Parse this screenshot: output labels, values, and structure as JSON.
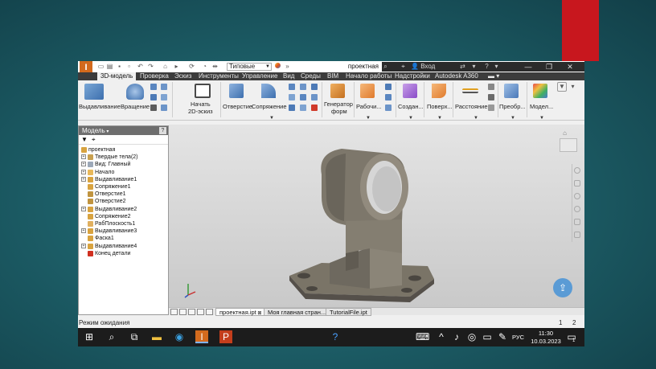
{
  "titlebar": {
    "style_dropdown": "Типовые",
    "document_title": "проектная",
    "signin": "Вход",
    "minimize": "—",
    "maximize": "❐",
    "close": "✕"
  },
  "menu": {
    "tabs": [
      "3D-модель",
      "Проверка",
      "Эскиз",
      "Инструменты",
      "Управление",
      "Вид",
      "Среды",
      "BIM",
      "Начало работы",
      "Надстройки",
      "Autodesk A360"
    ]
  },
  "ribbon": {
    "extrude": "Выдавливание",
    "revolve": "Вращение",
    "start_sketch_1": "Начать",
    "start_sketch_2": "2D-эскиз",
    "hole": "Отверстие",
    "fillet": "Сопряжение",
    "frame_gen_1": "Генератор",
    "frame_gen_2": "форм",
    "work": "Рабочи...",
    "create": "Создан...",
    "surface": "Поверх...",
    "distance": "Расстояние",
    "convert": "Преобр...",
    "model": "Модел..."
  },
  "browser": {
    "title": "Модель",
    "items": [
      {
        "label": "проектная",
        "level": 0,
        "expand": false,
        "icon": "part-icon",
        "color": "#d8a340"
      },
      {
        "label": "Твердые тела(2)",
        "level": 1,
        "expand": true,
        "icon": "solid-bodies-icon",
        "color": "#c8a050"
      },
      {
        "label": "Вид: Главный",
        "level": 1,
        "expand": true,
        "icon": "view-icon",
        "color": "#9ca8b8"
      },
      {
        "label": "Начало",
        "level": 1,
        "expand": true,
        "icon": "origin-icon",
        "color": "#e8b85a"
      },
      {
        "label": "Выдавливание1",
        "level": 1,
        "expand": true,
        "icon": "extrude-icon",
        "color": "#d8a340"
      },
      {
        "label": "Сопряжение1",
        "level": 1,
        "expand": false,
        "icon": "fillet-icon",
        "color": "#d8a340"
      },
      {
        "label": "Отверстие1",
        "level": 1,
        "expand": false,
        "icon": "hole-icon",
        "color": "#c09440"
      },
      {
        "label": "Отверстие2",
        "level": 1,
        "expand": false,
        "icon": "hole-icon",
        "color": "#c09440"
      },
      {
        "label": "Выдавливание2",
        "level": 1,
        "expand": true,
        "icon": "extrude-icon",
        "color": "#d8a340"
      },
      {
        "label": "Сопряжение2",
        "level": 1,
        "expand": false,
        "icon": "fillet-icon",
        "color": "#d8a340"
      },
      {
        "label": "РабПлоскость1",
        "level": 1,
        "expand": false,
        "icon": "workplane-icon",
        "color": "#e0b060"
      },
      {
        "label": "Выдавливание3",
        "level": 1,
        "expand": true,
        "icon": "extrude-icon",
        "color": "#d8a340"
      },
      {
        "label": "Фаска1",
        "level": 1,
        "expand": false,
        "icon": "chamfer-icon",
        "color": "#d8a340"
      },
      {
        "label": "Выдавливание4",
        "level": 1,
        "expand": true,
        "icon": "extrude-icon",
        "color": "#d8a340"
      },
      {
        "label": "Конец детали",
        "level": 1,
        "expand": false,
        "icon": "end-of-part-icon",
        "color": "#d03020"
      }
    ]
  },
  "doc_tabs": [
    {
      "label": "проектная.ipt",
      "active": true
    },
    {
      "label": "Моя главная стран...",
      "active": false
    },
    {
      "label": "TutorialFile.ipt",
      "active": false
    }
  ],
  "status": {
    "text": "Режим ожидания",
    "n1": "1",
    "n2": "2"
  },
  "taskbar": {
    "lang": "РУС",
    "time": "11:30",
    "date": "10.03.2023",
    "notif_count": "1"
  }
}
